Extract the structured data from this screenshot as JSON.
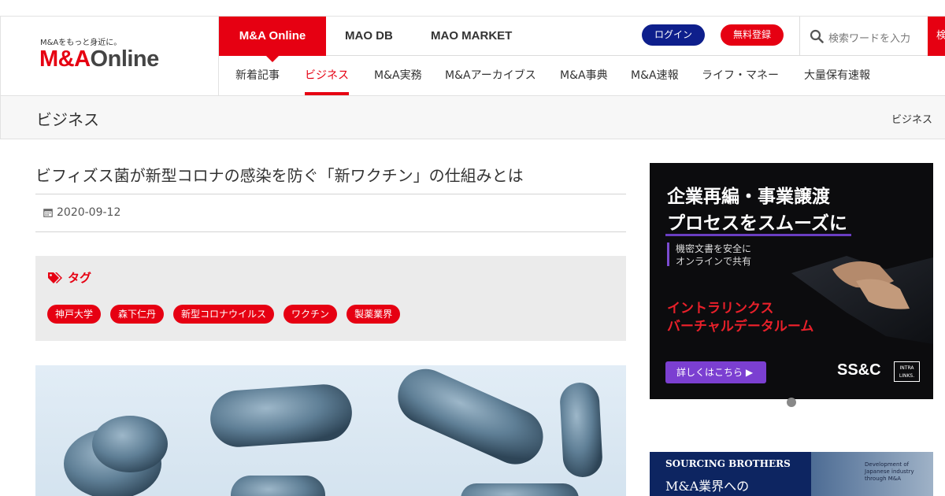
{
  "site": {
    "tagline": "M&Aをもっと身近に。",
    "logo_part1": "M&A",
    "logo_part2": "Online"
  },
  "nav_top": {
    "tabs": [
      {
        "label": "M&A Online"
      },
      {
        "label": "MAO DB"
      },
      {
        "label": "MAO MARKET"
      }
    ],
    "login_label": "ログイン",
    "register_label": "無料登録",
    "search_placeholder": "検索ワードを入力",
    "search_button_label": "検索"
  },
  "nav_sub": {
    "items": [
      {
        "label": "新着記事"
      },
      {
        "label": "ビジネス"
      },
      {
        "label": "M&A実務"
      },
      {
        "label": "M&Aアーカイブス"
      },
      {
        "label": "M&A事典"
      },
      {
        "label": "M&A速報"
      },
      {
        "label": "ライフ・マネー"
      },
      {
        "label": "大量保有速報"
      }
    ]
  },
  "category": {
    "title": "ビジネス",
    "breadcrumb": "ビジネス"
  },
  "article": {
    "title": "ビフィズス菌が新型コロナの感染を防ぐ「新ワクチン」の仕組みとは",
    "date": "2020-09-12",
    "tag_heading": "タグ",
    "tags": [
      "神戸大学",
      "森下仁丹",
      "新型コロナウイルス",
      "ワクチン",
      "製薬業界"
    ]
  },
  "ad_primary": {
    "headline1": "企業再編・事業譲渡",
    "headline2": "プロセスをスムーズに",
    "sub1": "機密文書を安全に",
    "sub2": "オンラインで共有",
    "product1": "イントラリンクス",
    "product2": "バーチャルデータルーム",
    "cta": "詳しくはこちら ▶",
    "brand": "SS&C",
    "brand2": "INTRA LINKS."
  },
  "ad_secondary": {
    "brand": "SOURCING BROTHERS",
    "copy": "M&A業界への",
    "note": "Development of Japanese industry through M&A"
  },
  "colors": {
    "brand_red": "#e60012",
    "login_navy": "#0e1f8c",
    "ad_purple": "#7b3fd1"
  }
}
